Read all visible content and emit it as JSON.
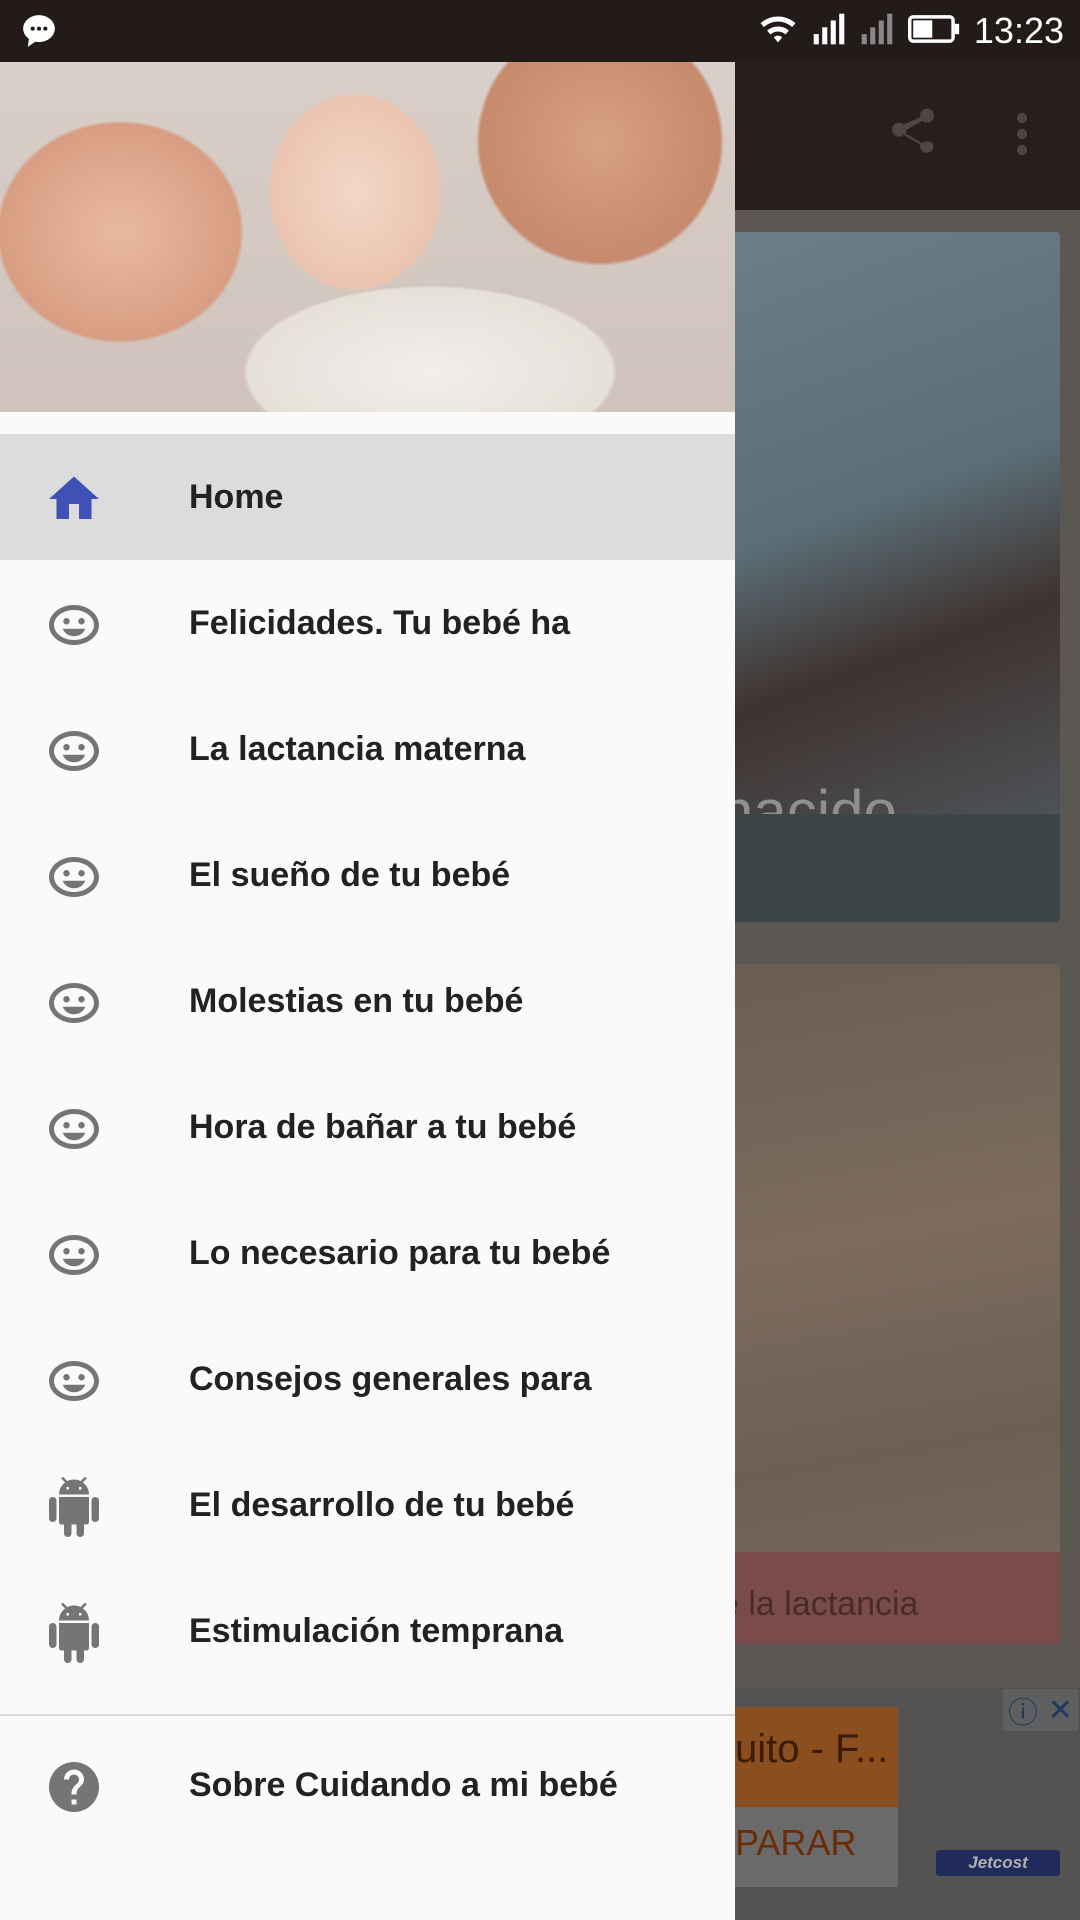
{
  "status_bar": {
    "time": "13:23",
    "icons": [
      "message-icon",
      "wifi-icon",
      "signal-icon",
      "signal-off-icon",
      "battery-icon"
    ]
  },
  "background_app": {
    "card1_title": "nacido",
    "card2_title": "e la lactancia",
    "ad": {
      "headline": "uito - F...",
      "cta": "PARAR",
      "brand": "Jetcost",
      "info_icon": "ⓘ",
      "close_icon": "✕"
    }
  },
  "drawer": {
    "items": [
      {
        "label": "Home",
        "icon": "home-icon",
        "active": true
      },
      {
        "label": "Felicidades. Tu bebé ha",
        "icon": "baby-face-icon"
      },
      {
        "label": "La lactancia materna",
        "icon": "baby-face-icon"
      },
      {
        "label": "El sueño de tu bebé",
        "icon": "baby-face-icon"
      },
      {
        "label": "Molestias en tu bebé",
        "icon": "baby-face-icon"
      },
      {
        "label": "Hora de bañar a tu bebé",
        "icon": "baby-face-icon"
      },
      {
        "label": "Lo necesario para tu bebé",
        "icon": "baby-face-icon"
      },
      {
        "label": "Consejos generales para",
        "icon": "baby-face-icon"
      },
      {
        "label": "El desarrollo de tu bebé",
        "icon": "android-icon"
      },
      {
        "label": "Estimulación temprana",
        "icon": "android-icon"
      }
    ],
    "about": {
      "label": "Sobre Cuidando a mi bebé",
      "icon": "help-icon"
    }
  },
  "colors": {
    "accent": "#3f51b5",
    "icon_gray": "#757575",
    "active_row": "#dcdcdc",
    "status_bar": "#231a1a"
  }
}
